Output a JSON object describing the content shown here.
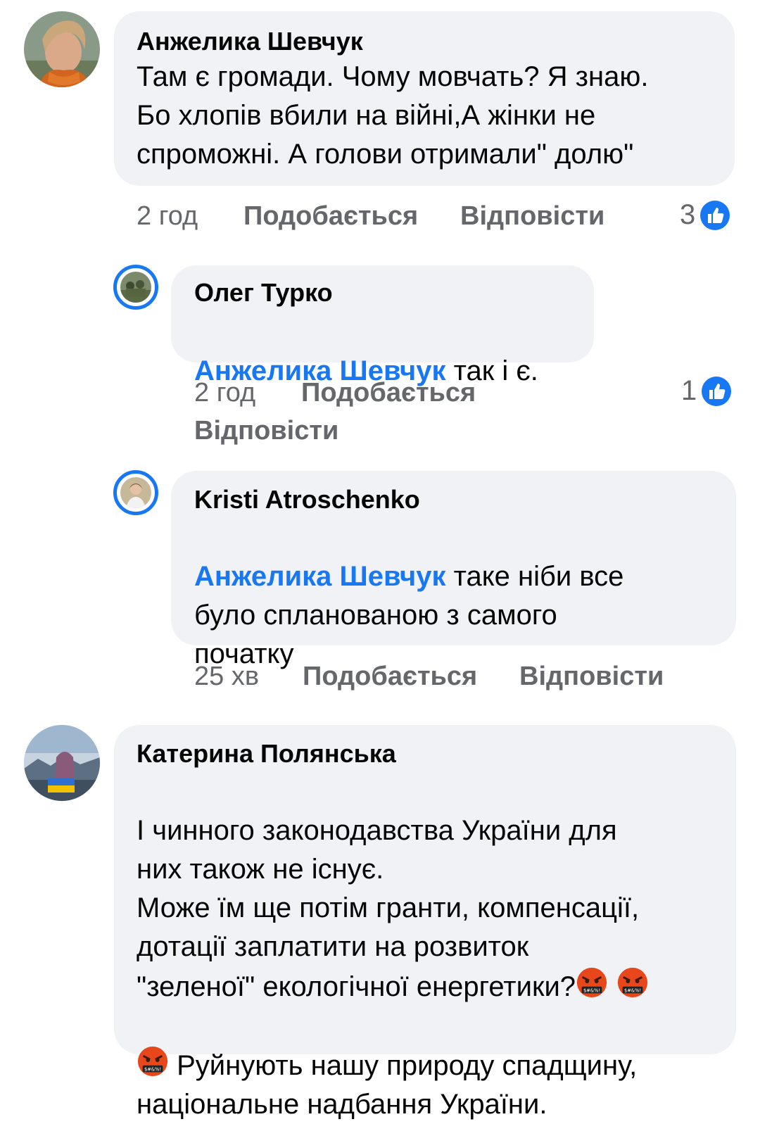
{
  "comments": [
    {
      "author": "Анжелика Шевчук",
      "text": "Там є громади. Чому мовчать? Я знаю.\nБо хлопів вбили на війні,А жінки не\nспроможні. А голови отримали\" долю\"",
      "time": "2 год",
      "like_label": "Подобається",
      "reply_label": "Відповісти",
      "reactions": "3"
    },
    {
      "author": "Олег Турко",
      "mention": "Анжелика Шевчук",
      "text": " так і є.",
      "time": "2 год",
      "like_label": "Подобається",
      "reply_label": "Відповісти",
      "reactions": "1"
    },
    {
      "author": "Kristi  Atroschenko",
      "mention": "Анжелика Шевчук",
      "text_line1": " таке ніби все",
      "text_rest": "було спланованою з самого\nпочатку",
      "time": "25 хв",
      "like_label": "Подобається",
      "reply_label": "Відповісти"
    },
    {
      "author": "Катерина Полянська",
      "text_a": "І чинного законодавства України для\nних також не існує.\nМоже їм ще потім гранти, компенсації,\nдотації заплатити на розвиток\n\"зеленої\" екологічної  енергетики?",
      "text_b": "  Руйнують нашу природу спадщину,\nнаціональне надбання України."
    }
  ],
  "colors": {
    "link": "#1877f2",
    "bubble": "#f0f2f5",
    "meta": "#65676b"
  },
  "icons": [
    "like-icon",
    "angry-cursing-face-icon"
  ]
}
